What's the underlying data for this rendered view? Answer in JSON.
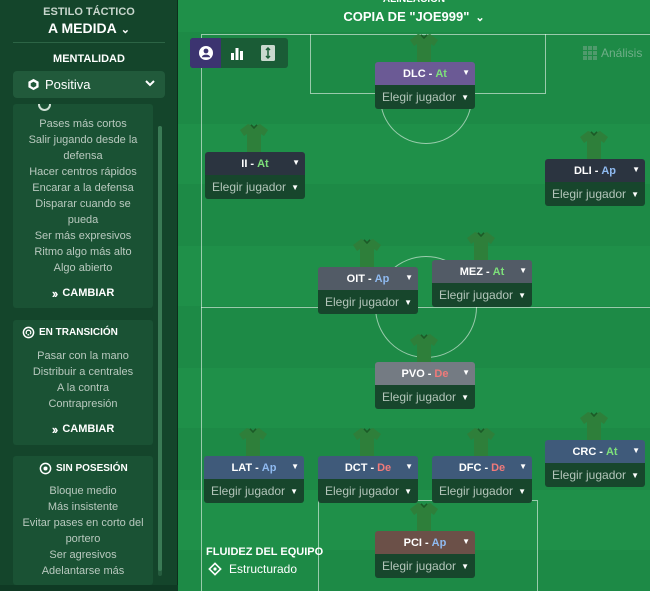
{
  "left_panel": {
    "style_label": "ESTILO TÁCTICO",
    "style_value": "A MEDIDA",
    "mentality_label": "MENTALIDAD",
    "mentality_value": "Positiva",
    "cards": [
      {
        "title": "",
        "items": [
          "Pases más cortos",
          "Salir jugando desde la",
          "defensa",
          "Hacer centros rápidos",
          "Encarar a la defensa",
          "Disparar cuando se",
          "pueda",
          "Ser más expresivos",
          "Ritmo algo más alto",
          "Algo abierto"
        ],
        "change": "CAMBIAR"
      },
      {
        "title": "EN TRANSICIÓN",
        "items": [
          "Pasar con la mano",
          "Distribuir a centrales",
          "A la contra",
          "Contrapresión"
        ],
        "change": "CAMBIAR"
      },
      {
        "title": "SIN POSESIÓN",
        "items": [
          "Bloque medio",
          "Más insistente",
          "Evitar pases en corto del",
          "portero",
          "Ser agresivos",
          "Adelantarse más"
        ]
      }
    ]
  },
  "pitch": {
    "title": "COPIA DE \"JOE999\"",
    "analysis_label": "Análisis",
    "flow_label": "FLUIDEZ DEL EQUIPO",
    "flow_value": "Estructurado",
    "pick_label": "Elegir jugador",
    "players": [
      {
        "role": "DLC",
        "duty": "At",
        "color": "#6b5a95"
      },
      {
        "role": "II",
        "duty": "At",
        "color": "#2b3440"
      },
      {
        "role": "DLI",
        "duty": "Ap",
        "color": "#2b3440"
      },
      {
        "role": "OIT",
        "duty": "Ap",
        "color": "#525b66"
      },
      {
        "role": "MEZ",
        "duty": "At",
        "color": "#525b66"
      },
      {
        "role": "PVO",
        "duty": "De",
        "color": "#747b83"
      },
      {
        "role": "LAT",
        "duty": "Ap",
        "color": "#3f5a7a"
      },
      {
        "role": "DCT",
        "duty": "De",
        "color": "#3f5a7a"
      },
      {
        "role": "DFC",
        "duty": "De",
        "color": "#3f5a7a"
      },
      {
        "role": "CRC",
        "duty": "At",
        "color": "#3f5a7a"
      },
      {
        "role": "PCI",
        "duty": "Ap",
        "color": "#6b5048"
      }
    ]
  },
  "icons": {
    "mentality": "shield-hex-icon",
    "transition": "cycle-icon",
    "out_of_possession": "target-icon",
    "view_players": "user-icon",
    "view_stats": "bar-chart-icon",
    "view_pitch": "pitch-icon",
    "analysis": "grid-icon",
    "flow": "diamond-icon"
  }
}
